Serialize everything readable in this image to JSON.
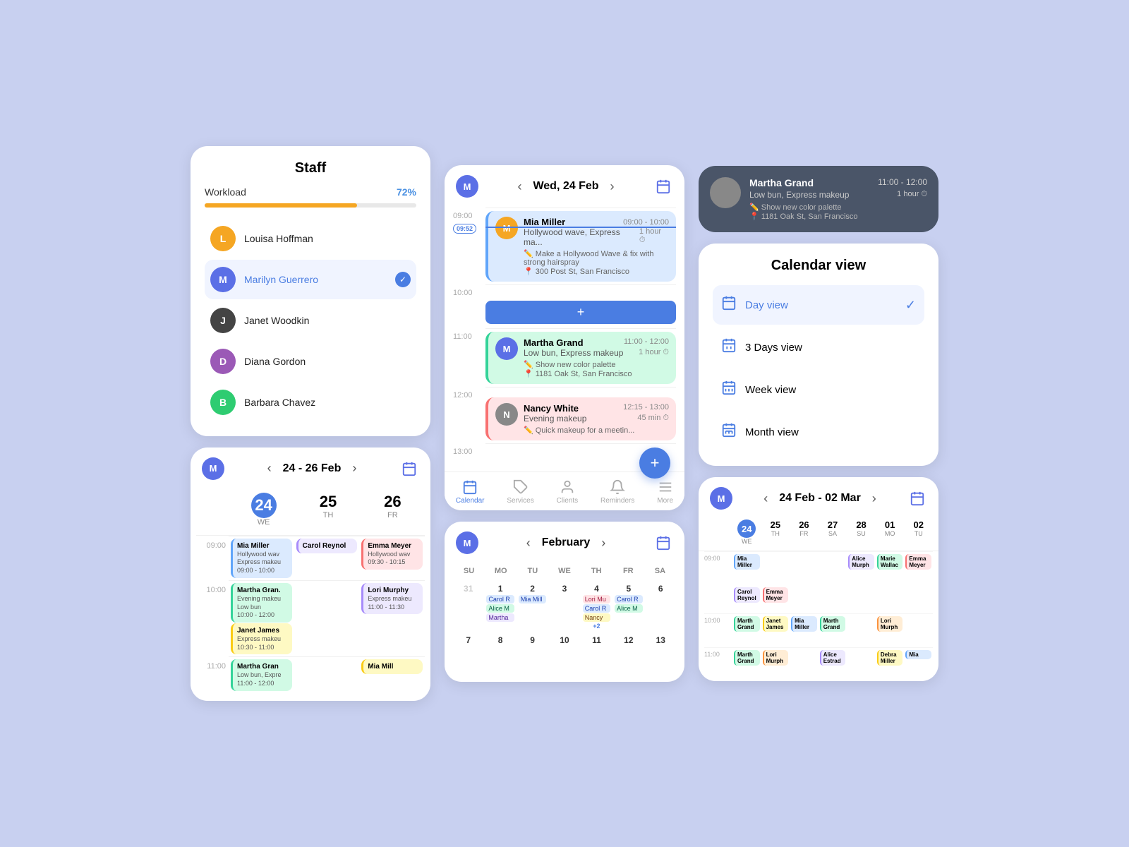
{
  "app": {
    "avatar_initial": "M",
    "avatar_bg": "#5b6fe6"
  },
  "staff_panel": {
    "title": "Staff",
    "workload_label": "Workload",
    "workload_pct": "72%",
    "workload_value": 72,
    "members": [
      {
        "initial": "L",
        "name": "Louisa Hoffman",
        "bg": "#f5a623",
        "selected": false
      },
      {
        "initial": "M",
        "name": "Marilyn Guerrero",
        "bg": "#5b6fe6",
        "selected": true
      },
      {
        "initial": "J",
        "name": "Janet Woodkin",
        "bg": "#333",
        "selected": false
      },
      {
        "initial": "D",
        "name": "Diana Gordon",
        "bg": "#9b59b6",
        "selected": false
      },
      {
        "initial": "B",
        "name": "Barbara Chavez",
        "bg": "#2ecc71",
        "selected": false
      }
    ]
  },
  "three_day": {
    "date_range": "24 - 26 Feb",
    "days": [
      {
        "num": "24",
        "lbl": "WE",
        "today": true
      },
      {
        "num": "25",
        "lbl": "TH",
        "today": false
      },
      {
        "num": "26",
        "lbl": "FR",
        "today": false
      }
    ],
    "times": [
      "09:00",
      "10:00",
      "11:00"
    ],
    "appointments": [
      {
        "day": 0,
        "time_slot": "09:00",
        "name": "Mia Miller",
        "service": "Hollywood wav",
        "service2": "Express makeu",
        "time": "09:00 - 10:00",
        "color": "blue"
      },
      {
        "day": 1,
        "time_slot": "09:00",
        "name": "Carol Reynol",
        "service": "",
        "time": "",
        "color": "purple"
      },
      {
        "day": 2,
        "time_slot": "09:00",
        "name": "Emma Meyer",
        "service": "Hollywood wav",
        "time": "09:30 - 10:15",
        "color": "pink"
      },
      {
        "day": 0,
        "time_slot": "10:00",
        "name": "Martha Gran.",
        "service": "Evening makeu",
        "service2": "Low bun",
        "time": "10:00 - 12:00",
        "color": "teal"
      },
      {
        "day": 0,
        "time_slot": "10:00",
        "name": "Janet James",
        "service": "Express makeu",
        "time": "10:30 - 11:00",
        "color": "yellow"
      },
      {
        "day": 2,
        "time_slot": "10:00",
        "name": "Lori Murphy",
        "service": "Express makeu",
        "time": "11:00 - 11:30",
        "color": "purple"
      },
      {
        "day": 0,
        "time_slot": "11:00",
        "name": "Martha Gran",
        "service": "Low bun, Expre",
        "time": "11:00 - 12:00",
        "color": "teal"
      }
    ]
  },
  "day_view": {
    "date": "Wed, 24 Feb",
    "time_now": "09:52",
    "appointments": [
      {
        "client": "Mia Miller",
        "service": "Hollywood wave, Express ma...",
        "time_range": "09:00 - 10:00",
        "duration": "1 hour",
        "note": "Make a Hollywood Wave & fix with strong hairspray",
        "location": "300 Post St, San Francisco",
        "color": "blue"
      },
      {
        "client": "Martha Grand",
        "service": "Low bun, Express makeup",
        "time_range": "11:00 - 12:00",
        "duration": "1 hour",
        "note": "Show new color palette",
        "location": "1181 Oak St, San Francisco",
        "color": "teal"
      },
      {
        "client": "Nancy White",
        "service": "Evening makeup",
        "time_range": "12:15 - 13:00",
        "duration": "45 min",
        "note": "Quick makeup for a meetin...",
        "location": "",
        "color": "pink"
      }
    ],
    "nav": [
      {
        "label": "Calendar",
        "icon": "📅",
        "active": true
      },
      {
        "label": "Services",
        "icon": "🏷",
        "active": false
      },
      {
        "label": "Clients",
        "icon": "👤",
        "active": false
      },
      {
        "label": "Reminders",
        "icon": "🔔",
        "active": false
      },
      {
        "label": "More",
        "icon": "≡",
        "active": false
      }
    ]
  },
  "month_view": {
    "month": "February",
    "day_headers": [
      "SU",
      "MO",
      "TU",
      "WE",
      "TH",
      "FR",
      "SA"
    ],
    "weeks": [
      [
        {
          "num": "31",
          "other": true,
          "appts": []
        },
        {
          "num": "1",
          "appts": [
            "Carol R",
            "Alice M",
            "Martha"
          ]
        },
        {
          "num": "2",
          "appts": [
            "Mia Mill"
          ]
        },
        {
          "num": "3",
          "appts": []
        },
        {
          "num": "4",
          "appts": [
            "Lori Mu",
            "Carol R",
            "Nancy"
          ]
        },
        {
          "num": "5",
          "appts": [
            "Carol R",
            "Alice M"
          ]
        },
        {
          "num": "6",
          "appts": []
        }
      ],
      [
        {
          "num": "7",
          "appts": []
        },
        {
          "num": "8",
          "appts": []
        },
        {
          "num": "9",
          "appts": []
        },
        {
          "num": "10",
          "appts": []
        },
        {
          "num": "11",
          "appts": []
        },
        {
          "num": "12",
          "appts": []
        },
        {
          "num": "13",
          "appts": []
        }
      ]
    ],
    "appt_colors": [
      "#dbeafe",
      "#d1fae5",
      "#ede9fe",
      "#ffedd5",
      "#ffe4e6"
    ]
  },
  "top_card": {
    "name": "Martha Grand",
    "time_range": "11:00 - 12:00",
    "duration": "1 hour",
    "service": "Low bun, Express makeup",
    "note": "Show new color palette",
    "location": "1181 Oak St, San Francisco"
  },
  "cal_view": {
    "title": "Calendar view",
    "options": [
      {
        "label": "Day view",
        "selected": true
      },
      {
        "label": "3 Days view",
        "selected": false
      },
      {
        "label": "Week view",
        "selected": false
      },
      {
        "label": "Month view",
        "selected": false
      }
    ]
  },
  "week_view": {
    "date_range": "24 Feb - 02 Mar",
    "days": [
      {
        "num": "24",
        "lbl": "WE",
        "today": true
      },
      {
        "num": "25",
        "lbl": "TH",
        "today": false
      },
      {
        "num": "26",
        "lbl": "FR",
        "today": false
      },
      {
        "num": "27",
        "lbl": "SA",
        "today": false
      },
      {
        "num": "28",
        "lbl": "SU",
        "today": false
      },
      {
        "num": "01",
        "lbl": "MO",
        "today": false
      },
      {
        "num": "02",
        "lbl": "TU",
        "today": false
      }
    ],
    "times": [
      "09:00",
      "10:00",
      "11:00"
    ],
    "appointments": [
      {
        "day": 0,
        "row": 0,
        "name": "Mia Miller",
        "color": "w-blue"
      },
      {
        "day": 6,
        "row": 0,
        "name": "Emma Meyer",
        "color": "w-pink"
      },
      {
        "day": 0,
        "row": 1,
        "name": "Carol Reynol",
        "color": "w-purple"
      },
      {
        "day": 1,
        "row": 1,
        "name": "Emma Meyer",
        "color": "w-pink"
      },
      {
        "day": 5,
        "row": 1,
        "name": "Marie Wallac",
        "color": "w-teal"
      },
      {
        "day": 0,
        "row": 2,
        "name": "Marth Grand",
        "color": "w-teal"
      },
      {
        "day": 3,
        "row": 2,
        "name": "Marth Grand",
        "color": "w-teal"
      },
      {
        "day": 1,
        "row": 3,
        "name": "Janet James",
        "color": "w-yellow"
      },
      {
        "day": 2,
        "row": 3,
        "name": "Mia Miller",
        "color": "w-blue"
      },
      {
        "day": 5,
        "row": 3,
        "name": "Lori Murph",
        "color": "w-orange"
      },
      {
        "day": 0,
        "row": 4,
        "name": "Marth Grand",
        "color": "w-teal"
      },
      {
        "day": 1,
        "row": 4,
        "name": "Lori Murph",
        "color": "w-orange"
      },
      {
        "day": 3,
        "row": 4,
        "name": "Alice Estrad",
        "color": "w-purple"
      },
      {
        "day": 5,
        "row": 5,
        "name": "Debra Miller",
        "color": "w-yellow"
      }
    ]
  }
}
